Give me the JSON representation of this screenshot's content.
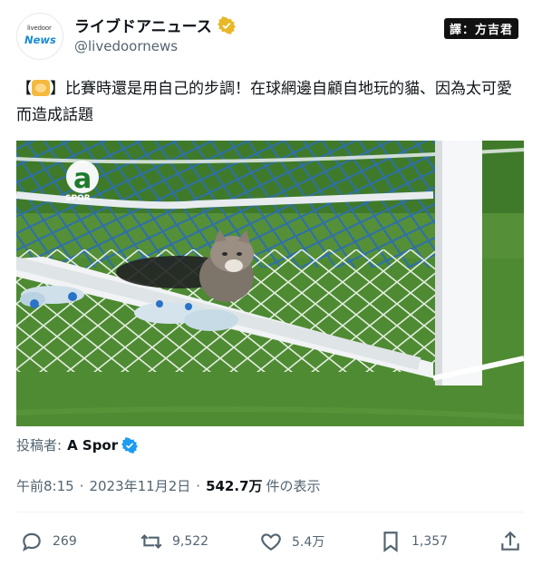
{
  "header": {
    "avatar_small": "livedoor",
    "avatar_big": "News",
    "name": "ライブドアニュース",
    "handle": "@livedoornews",
    "credit": "譯：方吉君",
    "verified_color": "#e8b829"
  },
  "tweet": {
    "text_bracket_open": "【",
    "emoji": "cat-face-icon",
    "text_body": "】比賽時還是用自己的步調！在球網邊自顧自地玩的貓、因為太可愛而造成話題"
  },
  "media": {
    "logo_letter": "a",
    "logo_text": "SPOR",
    "grass_color": "#4d8a32"
  },
  "poster": {
    "label": "投稿者:",
    "name": "A Spor",
    "verified_color": "#1d9bf0"
  },
  "meta": {
    "time": "午前8:15",
    "separator": "·",
    "date": "2023年11月2日",
    "views": "542.7万",
    "views_label": "件の表示"
  },
  "actions": {
    "replies": "269",
    "retweets": "9,522",
    "likes": "5.4万",
    "bookmarks": "1,357"
  }
}
